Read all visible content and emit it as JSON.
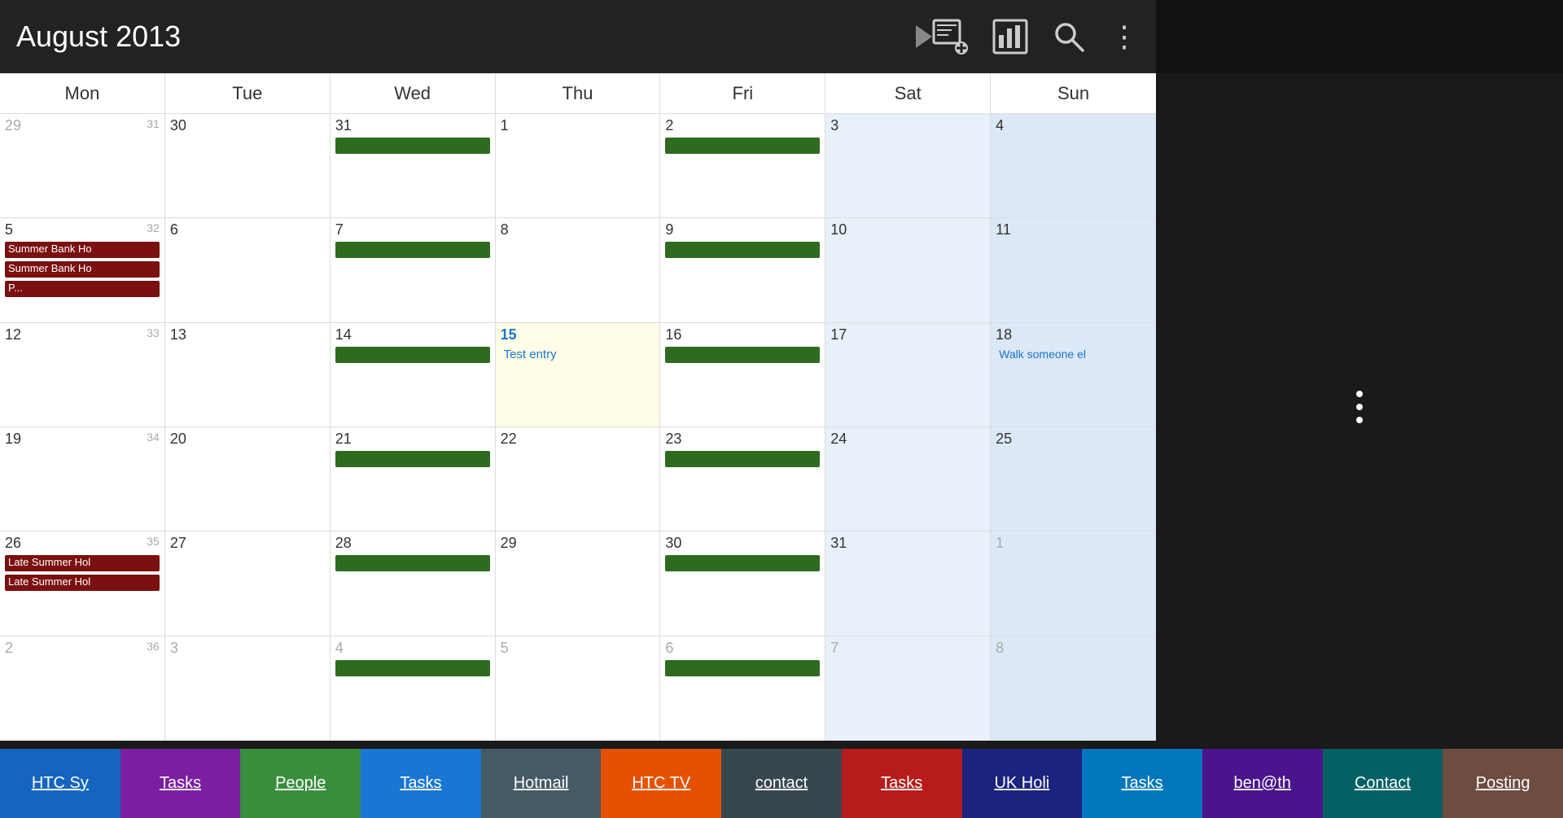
{
  "header": {
    "title": "August 2013",
    "icons": {
      "add_event": "⊞",
      "chart": "▦",
      "search": "🔍",
      "more": "⋮"
    }
  },
  "days": [
    "Mon",
    "Tue",
    "Wed",
    "Thu",
    "Fri",
    "Sat",
    "Sun"
  ],
  "weeks": [
    {
      "week_num": "",
      "cells": [
        {
          "date": "29",
          "other_month": true,
          "week": "31",
          "events": []
        },
        {
          "date": "30",
          "events": []
        },
        {
          "date": "31",
          "events": [
            {
              "type": "green",
              "label": ""
            }
          ]
        },
        {
          "date": "1",
          "events": []
        },
        {
          "date": "2",
          "events": [
            {
              "type": "green",
              "label": ""
            }
          ]
        },
        {
          "date": "3",
          "weekend": "sat",
          "events": []
        },
        {
          "date": "4",
          "weekend": "sun",
          "events": []
        }
      ]
    },
    {
      "cells": [
        {
          "date": "5",
          "week": "32",
          "events": [
            {
              "type": "red",
              "label": "Summer Bank Ho"
            },
            {
              "type": "red",
              "label": "Summer Bank Ho"
            },
            {
              "type": "red",
              "label": "P..."
            }
          ]
        },
        {
          "date": "6",
          "events": []
        },
        {
          "date": "7",
          "events": [
            {
              "type": "green",
              "label": ""
            }
          ]
        },
        {
          "date": "8",
          "events": []
        },
        {
          "date": "9",
          "events": [
            {
              "type": "green",
              "label": ""
            }
          ]
        },
        {
          "date": "10",
          "weekend": "sat",
          "events": []
        },
        {
          "date": "11",
          "weekend": "sun",
          "events": []
        }
      ]
    },
    {
      "cells": [
        {
          "date": "12",
          "week": "33",
          "events": []
        },
        {
          "date": "13",
          "events": []
        },
        {
          "date": "14",
          "events": [
            {
              "type": "green",
              "label": ""
            }
          ]
        },
        {
          "date": "15",
          "today": true,
          "events": [
            {
              "type": "entry",
              "label": "Test entry"
            }
          ]
        },
        {
          "date": "16",
          "events": [
            {
              "type": "green",
              "label": ""
            }
          ]
        },
        {
          "date": "17",
          "weekend": "sat",
          "events": []
        },
        {
          "date": "18",
          "weekend": "sun",
          "events": [
            {
              "type": "walk",
              "label": "Walk someone el"
            }
          ]
        }
      ]
    },
    {
      "cells": [
        {
          "date": "19",
          "week": "34",
          "events": []
        },
        {
          "date": "20",
          "events": []
        },
        {
          "date": "21",
          "events": [
            {
              "type": "green",
              "label": ""
            }
          ]
        },
        {
          "date": "22",
          "events": []
        },
        {
          "date": "23",
          "events": [
            {
              "type": "green",
              "label": ""
            }
          ]
        },
        {
          "date": "24",
          "weekend": "sat",
          "events": []
        },
        {
          "date": "25",
          "weekend": "sun",
          "events": []
        }
      ]
    },
    {
      "cells": [
        {
          "date": "26",
          "week": "35",
          "events": [
            {
              "type": "red",
              "label": "Late Summer Hol"
            },
            {
              "type": "red",
              "label": "Late Summer Hol"
            }
          ]
        },
        {
          "date": "27",
          "events": []
        },
        {
          "date": "28",
          "events": [
            {
              "type": "green",
              "label": ""
            }
          ]
        },
        {
          "date": "29",
          "events": []
        },
        {
          "date": "30",
          "events": [
            {
              "type": "green",
              "label": ""
            }
          ]
        },
        {
          "date": "31",
          "weekend": "sat",
          "events": []
        },
        {
          "date": "1",
          "weekend": "sun",
          "other_month": true,
          "events": []
        }
      ]
    },
    {
      "cells": [
        {
          "date": "2",
          "week": "36",
          "other_month": true,
          "events": []
        },
        {
          "date": "3",
          "other_month": true,
          "events": []
        },
        {
          "date": "4",
          "other_month": true,
          "events": [
            {
              "type": "green",
              "label": ""
            }
          ]
        },
        {
          "date": "5",
          "other_month": true,
          "events": []
        },
        {
          "date": "6",
          "other_month": true,
          "events": [
            {
              "type": "green",
              "label": ""
            }
          ]
        },
        {
          "date": "7",
          "other_month": true,
          "weekend": "sat",
          "events": []
        },
        {
          "date": "8",
          "other_month": true,
          "weekend": "sun",
          "events": []
        }
      ]
    }
  ],
  "tabs": [
    {
      "label": "HTC Sy",
      "bg": "#1565c0",
      "underline": true
    },
    {
      "label": "Tasks",
      "bg": "#7b1fa2",
      "underline": true
    },
    {
      "label": "People",
      "bg": "#388e3c",
      "underline": true
    },
    {
      "label": "Tasks",
      "bg": "#1976d2",
      "underline": true
    },
    {
      "label": "Hotmail",
      "bg": "#455a64",
      "underline": true
    },
    {
      "label": "HTC TV",
      "bg": "#e65100",
      "underline": true
    },
    {
      "label": "contact",
      "bg": "#37474f",
      "underline": true
    },
    {
      "label": "Tasks",
      "bg": "#b71c1c",
      "underline": true
    },
    {
      "label": "UK Holi",
      "bg": "#1a237e",
      "underline": true
    },
    {
      "label": "Tasks",
      "bg": "#0277bd",
      "underline": true
    },
    {
      "label": "ben@th",
      "bg": "#4a148c",
      "underline": true
    },
    {
      "label": "Contact",
      "bg": "#006064",
      "underline": true
    },
    {
      "label": "Posting",
      "bg": "#6d4c41",
      "underline": true
    }
  ]
}
